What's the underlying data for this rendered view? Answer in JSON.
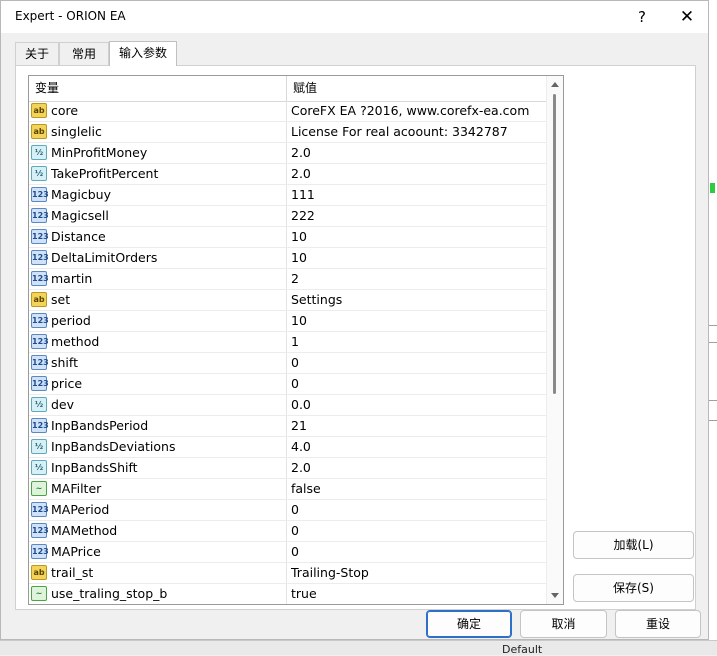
{
  "window": {
    "title": "Expert - ORION EA",
    "help_glyph": "?",
    "close_glyph": "✕"
  },
  "tabs": [
    {
      "label": "关于",
      "active": false
    },
    {
      "label": "常用",
      "active": false
    },
    {
      "label": "输入参数",
      "active": true
    }
  ],
  "grid": {
    "columns": [
      "变量",
      "赋值"
    ],
    "rows": [
      {
        "name": "core",
        "type": "string",
        "value": "CoreFX EA ?2016, www.corefx-ea.com"
      },
      {
        "name": "singlelic",
        "type": "string",
        "value": "License For real acoount: 3342787"
      },
      {
        "name": "MinProfitMoney",
        "type": "double",
        "value": "2.0"
      },
      {
        "name": "TakeProfitPercent",
        "type": "double",
        "value": "2.0"
      },
      {
        "name": "Magicbuy",
        "type": "int",
        "value": "111"
      },
      {
        "name": "Magicsell",
        "type": "int",
        "value": "222"
      },
      {
        "name": "Distance",
        "type": "int",
        "value": "10"
      },
      {
        "name": "DeltaLimitOrders",
        "type": "int",
        "value": "10"
      },
      {
        "name": "martin",
        "type": "int",
        "value": "2"
      },
      {
        "name": "set",
        "type": "string",
        "value": "Settings"
      },
      {
        "name": "period",
        "type": "int",
        "value": "10"
      },
      {
        "name": "method",
        "type": "int",
        "value": "1"
      },
      {
        "name": "shift",
        "type": "int",
        "value": "0"
      },
      {
        "name": "price",
        "type": "int",
        "value": "0"
      },
      {
        "name": "dev",
        "type": "double",
        "value": "0.0"
      },
      {
        "name": "InpBandsPeriod",
        "type": "int",
        "value": "21"
      },
      {
        "name": "InpBandsDeviations",
        "type": "double",
        "value": "4.0"
      },
      {
        "name": "InpBandsShift",
        "type": "double",
        "value": "2.0"
      },
      {
        "name": "MAFilter",
        "type": "bool",
        "value": "false"
      },
      {
        "name": "MAPeriod",
        "type": "int",
        "value": "0"
      },
      {
        "name": "MAMethod",
        "type": "int",
        "value": "0"
      },
      {
        "name": "MAPrice",
        "type": "int",
        "value": "0"
      },
      {
        "name": "trail_st",
        "type": "string",
        "value": "Trailing-Stop"
      },
      {
        "name": "use_traling_stop_b",
        "type": "bool",
        "value": "true"
      }
    ]
  },
  "icons": {
    "string": "ab",
    "int": "123",
    "double": "½",
    "bool": "~"
  },
  "buttons": {
    "load": "加载(L)",
    "save": "保存(S)",
    "ok": "确定",
    "cancel": "取消",
    "reset": "重设"
  },
  "background": {
    "status_text": "Default"
  },
  "colors": {
    "primary_border": "#2d6fc9",
    "string_icon": "#f3d35a",
    "int_icon": "#cfe2f8"
  }
}
